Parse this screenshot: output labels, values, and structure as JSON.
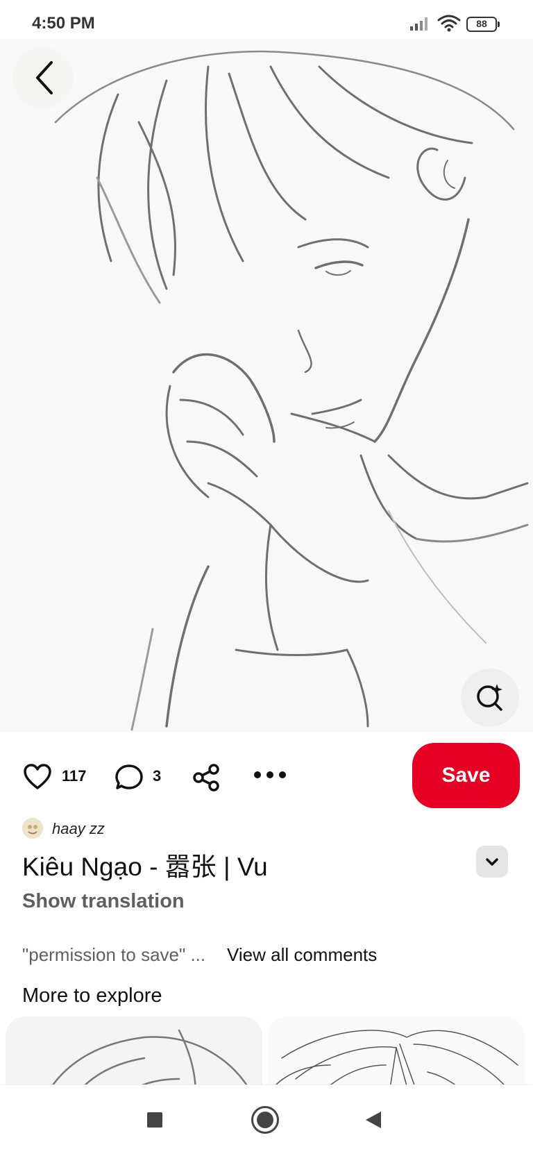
{
  "status_bar": {
    "time": "4:50 PM",
    "battery": "88"
  },
  "pin": {
    "image_alt": "Pencil sketch of a young man resting his cheek on his hand"
  },
  "actions": {
    "like_count": "117",
    "comment_count": "3",
    "save_label": "Save"
  },
  "author": {
    "name": "haay zz"
  },
  "title": "Kiêu Ngạo - 嚣张 | Vu",
  "show_translation": "Show translation",
  "comments": {
    "preview": "\"permission to save\" ...",
    "view_all": "View all comments"
  },
  "explore": {
    "heading": "More to explore"
  },
  "colors": {
    "save_button": "#e60023",
    "muted_text": "#5f5f5f"
  },
  "icons": [
    "back-arrow-icon",
    "visual-search-icon",
    "heart-icon",
    "comment-icon",
    "share-icon",
    "more-icon",
    "chevron-down-icon"
  ]
}
